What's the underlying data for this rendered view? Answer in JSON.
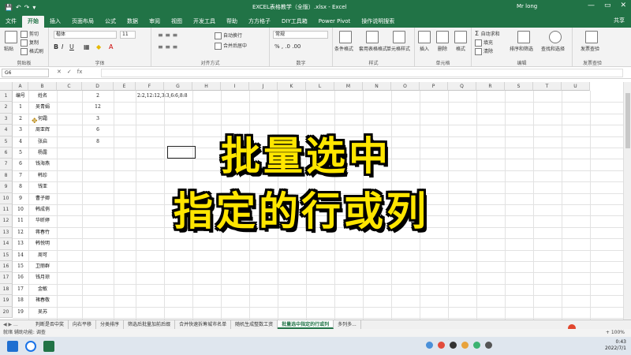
{
  "window": {
    "title": "EXCEL表格教学（全版）.xlsx - Excel",
    "user": "Mr long",
    "quick_access": [
      "💾",
      "↶",
      "↷",
      "▾"
    ],
    "controls": [
      "—",
      "▭",
      "✕"
    ]
  },
  "menu": {
    "tabs": [
      "文件",
      "开始",
      "插入",
      "页面布局",
      "公式",
      "数据",
      "审阅",
      "视图",
      "开发工具",
      "帮助",
      "方方格子",
      "DIY工具箱",
      "Power Pivot",
      "操作说明搜索"
    ],
    "active_index": 1,
    "share": "共享"
  },
  "ribbon": {
    "clipboard": {
      "label": "剪贴板",
      "paste": "粘贴",
      "cut": "剪切",
      "copy": "复制",
      "format_painter": "格式刷"
    },
    "font": {
      "label": "字体",
      "font_name": "楷体",
      "font_size": "11"
    },
    "alignment": {
      "label": "对齐方式",
      "wrap": "自动换行",
      "merge": "合并后居中"
    },
    "number": {
      "label": "数字",
      "format": "常规"
    },
    "styles": {
      "label": "样式",
      "conditional": "条件格式",
      "table": "套用表格格式",
      "cell_styles": "单元格样式"
    },
    "cells": {
      "label": "单元格",
      "insert": "插入",
      "delete": "删除",
      "format": "格式"
    },
    "editing": {
      "label": "编辑",
      "autosum": "自动求和",
      "fill": "填充",
      "clear": "清除",
      "sort": "排序和筛选",
      "find": "查找和选择"
    },
    "invoice": {
      "label": "发票查验",
      "check": "发票查验"
    }
  },
  "formula_bar": {
    "name_box": "G6",
    "icons": [
      "✕",
      "✓",
      "fx"
    ],
    "value": ""
  },
  "columns": [
    "A",
    "B",
    "C",
    "D",
    "E",
    "F",
    "G",
    "H",
    "I",
    "J",
    "K",
    "L",
    "M",
    "N",
    "O",
    "P",
    "Q",
    "R",
    "S",
    "T",
    "U"
  ],
  "rows": [
    "1",
    "2",
    "3",
    "4",
    "5",
    "6",
    "7",
    "8",
    "9",
    "10",
    "11",
    "12",
    "13",
    "14",
    "15",
    "16",
    "17",
    "18",
    "19",
    "20"
  ],
  "sheet": {
    "headers": {
      "a1": "编号",
      "b1": "姓名"
    },
    "col_a": [
      "1",
      "2",
      "3",
      "4",
      "5",
      "6",
      "7",
      "8",
      "9",
      "10",
      "11",
      "12",
      "13",
      "14",
      "15",
      "16",
      "17",
      "18",
      "19"
    ],
    "col_b": [
      "吴青娟",
      "何霜",
      "周亚辉",
      "张启",
      "杨露",
      "钱海燕",
      "韩珍",
      "钱亚",
      "曹子卿",
      "韩成俏",
      "华昕婷",
      "蒋春竹",
      "韩悦明",
      "周可",
      "卫丽群",
      "钱月琼",
      "金敏",
      "褚春敬",
      "吴苏"
    ],
    "col_d": [
      "2",
      "12",
      "3",
      "6",
      "8"
    ],
    "f1": "2:2,12:12,3:3,6:6,8:8"
  },
  "overlay": {
    "line1": "批量选中",
    "line2": "指定的行或列"
  },
  "sheet_tabs": {
    "nav": "◀ ▶ ...",
    "tabs": [
      "判断是否中奖",
      "向右平移",
      "分类排序",
      "筛选后批量加前后缀",
      "合并快速拆筹城市名单",
      "随机生成整数工资",
      "批量选中指定的行或列",
      "多列多..."
    ],
    "active_index": 6
  },
  "status": {
    "left": "就绪   辅助功能: 调查",
    "zoom": "+ 100%"
  },
  "taskbar": {
    "time": "0:43",
    "date": "2022/7/1"
  }
}
